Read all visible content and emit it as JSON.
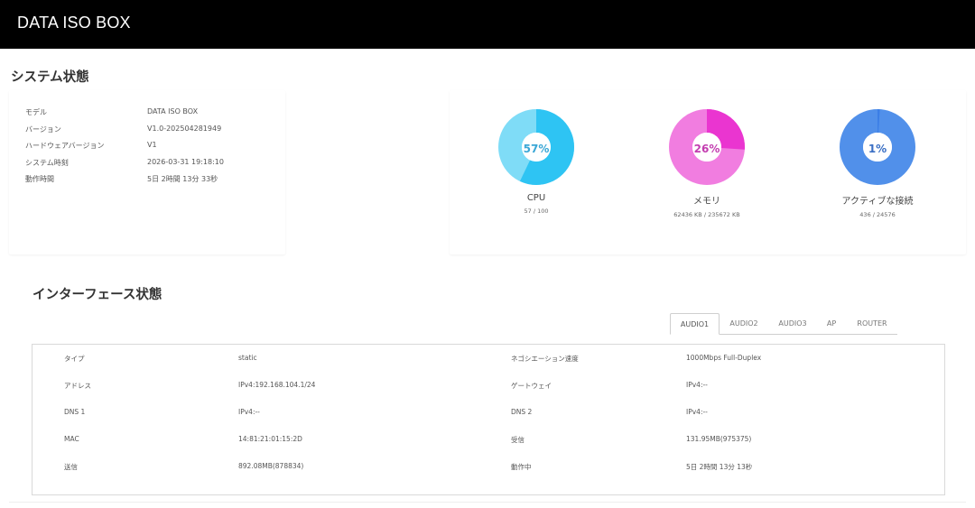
{
  "app": {
    "title": "DATA ISO BOX"
  },
  "system": {
    "title": "システム状態",
    "rows": [
      {
        "label": "モデル",
        "value": "DATA ISO BOX"
      },
      {
        "label": "バージョン",
        "value": "V1.0-202504281949"
      },
      {
        "label": "ハードウェアバージョン",
        "value": "V1"
      },
      {
        "label": "システム時刻",
        "value": "2026-03-31 19:18:10"
      },
      {
        "label": "動作時間",
        "value": "5日 2時間 13分 33秒"
      }
    ]
  },
  "gauges": [
    {
      "percent_text": "57%",
      "fraction": 0.57,
      "label": "CPU",
      "detail": "57 / 100",
      "color": "#2ec4f3",
      "text_color": "#3aa7d6"
    },
    {
      "percent_text": "26%",
      "fraction": 0.26,
      "label": "メモリ",
      "detail": "62436 KB / 235672 KB",
      "color": "#ea35d0",
      "text_color": "#c33db0"
    },
    {
      "percent_text": "1%",
      "fraction": 0.01,
      "label": "アクティブな接続",
      "detail": "436 / 24576",
      "color": "#3b7ee6",
      "text_color": "#3a6fc4"
    }
  ],
  "interface": {
    "title": "インターフェース状態",
    "tabs": [
      "AUDIO1",
      "AUDIO2",
      "AUDIO3",
      "AP",
      "ROUTER"
    ],
    "active_tab": "AUDIO1",
    "rows": [
      {
        "k1": "タイプ",
        "v1": "static",
        "k2": "ネゴシエーション速度",
        "v2": "1000Mbps  Full-Duplex"
      },
      {
        "k1": "アドレス",
        "v1": "IPv4:192.168.104.1/24",
        "k2": "ゲートウェイ",
        "v2": "IPv4:--"
      },
      {
        "k1": "DNS 1",
        "v1": "IPv4:--",
        "k2": "DNS 2",
        "v2": "IPv4:--"
      },
      {
        "k1": "MAC",
        "v1": "14:81:21:01:15:2D",
        "k2": "受信",
        "v2": "131.95MB(975375)"
      },
      {
        "k1": "送信",
        "v1": "892.08MB(878834)",
        "k2": "動作中",
        "v2": "5日 2時間 13分 13秒"
      }
    ]
  }
}
